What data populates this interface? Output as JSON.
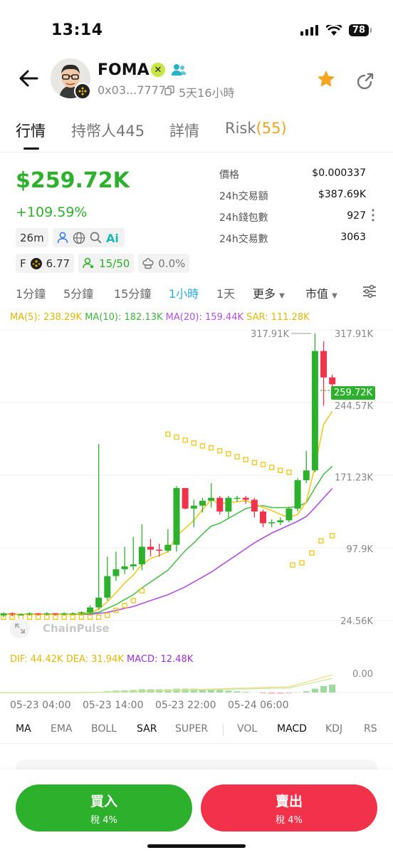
{
  "status_bar": {
    "time": "13:14",
    "battery": "78"
  },
  "token": {
    "name": "FOMA",
    "verify_badge": "✕",
    "address": "0x03...7777",
    "age": "5天16小時"
  },
  "tabs": [
    {
      "label": "行情"
    },
    {
      "label": "持幣人445"
    },
    {
      "label": "詳情"
    },
    {
      "label": "Risk",
      "count": "(55)"
    }
  ],
  "price": {
    "value": "$259.72K",
    "change": "+109.59%"
  },
  "chips": {
    "age": "26m",
    "f_label": "F",
    "f_value": "6.77",
    "holders": "15/50",
    "tax": "0.0%"
  },
  "stats": [
    {
      "label": "價格",
      "value": "$0.000337"
    },
    {
      "label": "24h交易額",
      "value": "$387.69K"
    },
    {
      "label": "24h錢包數",
      "value": "927"
    },
    {
      "label": "24h交易數",
      "value": "3063"
    }
  ],
  "timeframes": [
    "1分鐘",
    "5分鐘",
    "15分鐘",
    "1小時",
    "1天",
    "更多",
    "市值"
  ],
  "ma_legend": {
    "ma5": "MA(5): 238.29K",
    "ma10": "MA(10): 182.13K",
    "ma20": "MA(20): 159.44K",
    "sar": "SAR: 111.28K"
  },
  "macd_legend": {
    "dif": "DIF: 44.42K",
    "dea": "DEA: 31.94K",
    "macd": "MACD: 12.48K"
  },
  "watermark": "ChainPulse",
  "colors": {
    "up": "#2db12d",
    "down": "#f2324a",
    "ma5": "#f2c81e",
    "ma10": "#4cc24c",
    "ma20": "#b44ee0",
    "sar": "#f2c81e",
    "active": "#22aadd"
  },
  "chart_data": {
    "type": "candlestick",
    "y_axis_labels": [
      "317.91K",
      "244.57K",
      "171.23K",
      "97.9K",
      "24.56K"
    ],
    "y_axis_values": [
      317.91,
      244.57,
      171.23,
      97.9,
      24.56
    ],
    "macd_axis_label": "0.00",
    "high_marker": "317.91K",
    "current_price_label": "259.72K",
    "current_price": 259.72,
    "x_labels": [
      "05-23 04:00",
      "05-23 14:00",
      "05-23 22:00",
      "05-24 06:00"
    ],
    "candles": [
      {
        "o": 30,
        "c": 32,
        "h": 33,
        "l": 28
      },
      {
        "o": 32,
        "c": 31,
        "h": 33,
        "l": 29
      },
      {
        "o": 31,
        "c": 31,
        "h": 32,
        "l": 30
      },
      {
        "o": 31,
        "c": 32,
        "h": 33,
        "l": 30
      },
      {
        "o": 32,
        "c": 31,
        "h": 32,
        "l": 30
      },
      {
        "o": 31,
        "c": 32,
        "h": 33,
        "l": 30
      },
      {
        "o": 32,
        "c": 31,
        "h": 32,
        "l": 30
      },
      {
        "o": 31,
        "c": 32,
        "h": 33,
        "l": 30
      },
      {
        "o": 32,
        "c": 32,
        "h": 33,
        "l": 31
      },
      {
        "o": 32,
        "c": 33,
        "h": 34,
        "l": 31
      },
      {
        "o": 33,
        "c": 38,
        "h": 40,
        "l": 32
      },
      {
        "o": 38,
        "c": 48,
        "h": 205,
        "l": 36
      },
      {
        "o": 48,
        "c": 70,
        "h": 90,
        "l": 45
      },
      {
        "o": 70,
        "c": 77,
        "h": 95,
        "l": 65
      },
      {
        "o": 77,
        "c": 80,
        "h": 100,
        "l": 72
      },
      {
        "o": 80,
        "c": 82,
        "h": 110,
        "l": 76
      },
      {
        "o": 82,
        "c": 100,
        "h": 123,
        "l": 76
      },
      {
        "o": 100,
        "c": 97,
        "h": 108,
        "l": 90
      },
      {
        "o": 97,
        "c": 96,
        "h": 103,
        "l": 90
      },
      {
        "o": 96,
        "c": 102,
        "h": 118,
        "l": 94
      },
      {
        "o": 102,
        "c": 160,
        "h": 162,
        "l": 95
      },
      {
        "o": 160,
        "c": 139,
        "h": 158,
        "l": 138
      },
      {
        "o": 139,
        "c": 142,
        "h": 148,
        "l": 120
      },
      {
        "o": 142,
        "c": 147,
        "h": 150,
        "l": 135
      },
      {
        "o": 147,
        "c": 150,
        "h": 165,
        "l": 140
      },
      {
        "o": 150,
        "c": 136,
        "h": 152,
        "l": 133
      },
      {
        "o": 136,
        "c": 150,
        "h": 152,
        "l": 130
      },
      {
        "o": 150,
        "c": 150,
        "h": 152,
        "l": 146
      },
      {
        "o": 150,
        "c": 148,
        "h": 152,
        "l": 144
      },
      {
        "o": 148,
        "c": 136,
        "h": 150,
        "l": 130
      },
      {
        "o": 136,
        "c": 124,
        "h": 138,
        "l": 120
      },
      {
        "o": 124,
        "c": 125,
        "h": 128,
        "l": 120
      },
      {
        "o": 125,
        "c": 127,
        "h": 130,
        "l": 122
      },
      {
        "o": 127,
        "c": 139,
        "h": 141,
        "l": 125
      },
      {
        "o": 139,
        "c": 168,
        "h": 170,
        "l": 136
      },
      {
        "o": 168,
        "c": 178,
        "h": 198,
        "l": 165
      },
      {
        "o": 178,
        "c": 300,
        "h": 317.91,
        "l": 176
      },
      {
        "o": 300,
        "c": 273,
        "h": 310,
        "l": 244
      },
      {
        "o": 273,
        "c": 266,
        "h": 276,
        "l": 262
      }
    ],
    "series": [
      {
        "name": "MA(5)",
        "values": [
          31,
          31,
          31,
          31,
          31,
          31,
          31,
          31,
          31,
          32,
          33,
          36,
          44,
          53,
          63,
          71,
          82,
          88,
          91,
          95,
          111,
          119,
          127,
          138,
          148,
          144,
          145,
          146,
          147,
          144,
          140,
          137,
          133,
          130,
          133,
          146,
          182,
          225,
          238.29
        ]
      },
      {
        "name": "MA(10)",
        "values": [
          31,
          31,
          31,
          31,
          31,
          31,
          31,
          31,
          31,
          31,
          32,
          33,
          37,
          41,
          46,
          51,
          58,
          64,
          70,
          76,
          86,
          96,
          104,
          113,
          121,
          124,
          129,
          134,
          139,
          141,
          142,
          140,
          140,
          140,
          141,
          145,
          160,
          174,
          182.13
        ]
      },
      {
        "name": "MA(20)",
        "values": [
          31,
          31,
          31,
          31,
          31,
          31,
          31,
          31,
          31,
          31,
          31,
          32,
          33,
          35,
          37,
          39,
          42,
          45,
          48,
          51,
          55,
          59,
          64,
          69,
          74,
          80,
          86,
          92,
          98,
          104,
          109,
          114,
          118,
          122,
          126,
          131,
          140,
          150,
          159.44
        ]
      },
      {
        "name": "SAR",
        "values": [
          28,
          28,
          28,
          28,
          28,
          28,
          28,
          28,
          28,
          28,
          28,
          28,
          30,
          35,
          40,
          45,
          55,
          null,
          null,
          215,
          212,
          209,
          206,
          203,
          201,
          198,
          195,
          192,
          189,
          186,
          184,
          181,
          178,
          176,
          null,
          null,
          null,
          null,
          111.28
        ]
      }
    ],
    "macd": {
      "dif": 44.42,
      "dea": 31.94,
      "macd": 12.48,
      "histogram": [
        0,
        0,
        0,
        0,
        0,
        0,
        0,
        0,
        0,
        0,
        0.5,
        1,
        2,
        3,
        3.5,
        4,
        5,
        5,
        5,
        5,
        6,
        6,
        6,
        5,
        5,
        4,
        3,
        2,
        1,
        0,
        -1,
        -1.5,
        -1.5,
        -1,
        0.5,
        2,
        6,
        10,
        12.48
      ]
    }
  },
  "indicators": [
    "MA",
    "EMA",
    "BOLL",
    "SAR",
    "SUPER",
    "VOL",
    "MACD",
    "KDJ",
    "RS"
  ],
  "actions": {
    "buy_label": "買入",
    "buy_tax": "稅 4%",
    "sell_label": "賣出",
    "sell_tax": "稅 4%"
  }
}
